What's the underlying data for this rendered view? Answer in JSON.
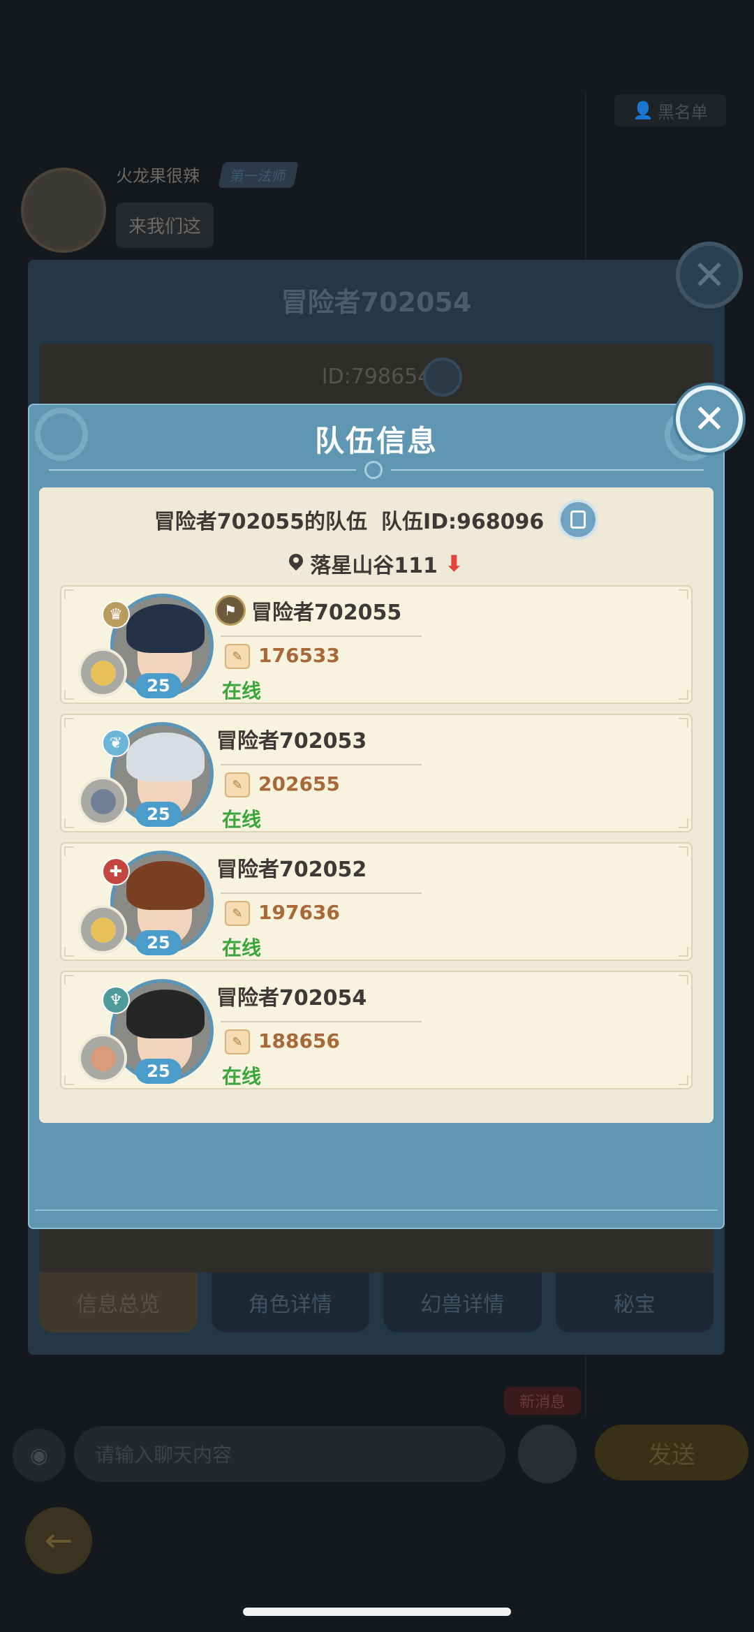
{
  "background_chat": {
    "blacklist_label": "黑名单",
    "sender_name": "火龙果很辣",
    "sender_tag": "第一法师",
    "message": "来我们这"
  },
  "player_panel": {
    "title": "冒险者702054",
    "id_text": "ID:798654",
    "tabs": [
      "信息总览",
      "角色详情",
      "幻兽详情",
      "秘宝"
    ]
  },
  "chat_bar": {
    "new_message": "新消息",
    "input_placeholder": "请输入聊天内容",
    "send_label": "发送"
  },
  "team_modal": {
    "title": "队伍信息",
    "team_name": "冒险者702055的队伍",
    "team_id": "队伍ID:968096",
    "location": "落星山谷111",
    "members": [
      {
        "name": "冒险者702055",
        "power": "176533",
        "status": "在线",
        "level": "25",
        "leader": true,
        "hair": "#233246",
        "pet": "#e8c05a",
        "class_color": "#b99b5e"
      },
      {
        "name": "冒险者702053",
        "power": "202655",
        "status": "在线",
        "level": "25",
        "leader": false,
        "hair": "#d8dde3",
        "pet": "#6f7f95",
        "class_color": "#6cb5d8"
      },
      {
        "name": "冒险者702052",
        "power": "197636",
        "status": "在线",
        "level": "25",
        "leader": false,
        "hair": "#7a3e22",
        "pet": "#e8c05a",
        "class_color": "#c4463e"
      },
      {
        "name": "冒险者702054",
        "power": "188656",
        "status": "在线",
        "level": "25",
        "leader": false,
        "hair": "#262626",
        "pet": "#d99c7a",
        "class_color": "#4f9a9a"
      }
    ]
  },
  "colors": {
    "modal_bg": "#5f97b3",
    "card_bg": "#efe9d7",
    "online_green": "#3aa53a",
    "power_brown": "#a8683a"
  }
}
